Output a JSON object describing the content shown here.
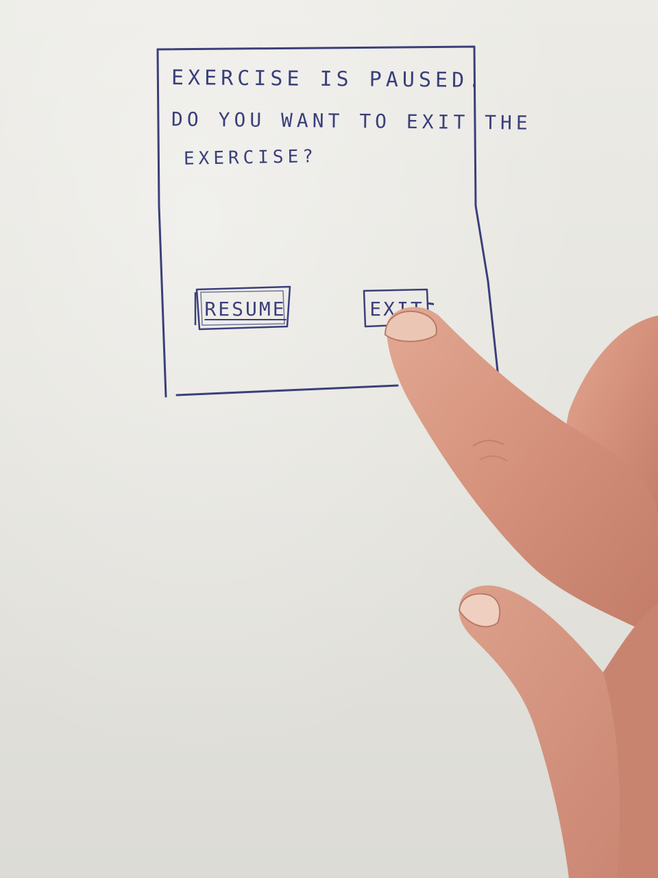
{
  "dialog": {
    "message_line1": "EXERCISE IS PAUSED.",
    "message_line2": "DO YOU WANT TO EXIT THE",
    "message_line3": "EXERCISE?",
    "resume_label": "RESUME",
    "exit_label": "EXIT"
  },
  "colors": {
    "ink": "#3a3f7a",
    "paper": "#e8e7e2",
    "skin": "#d99a86"
  }
}
